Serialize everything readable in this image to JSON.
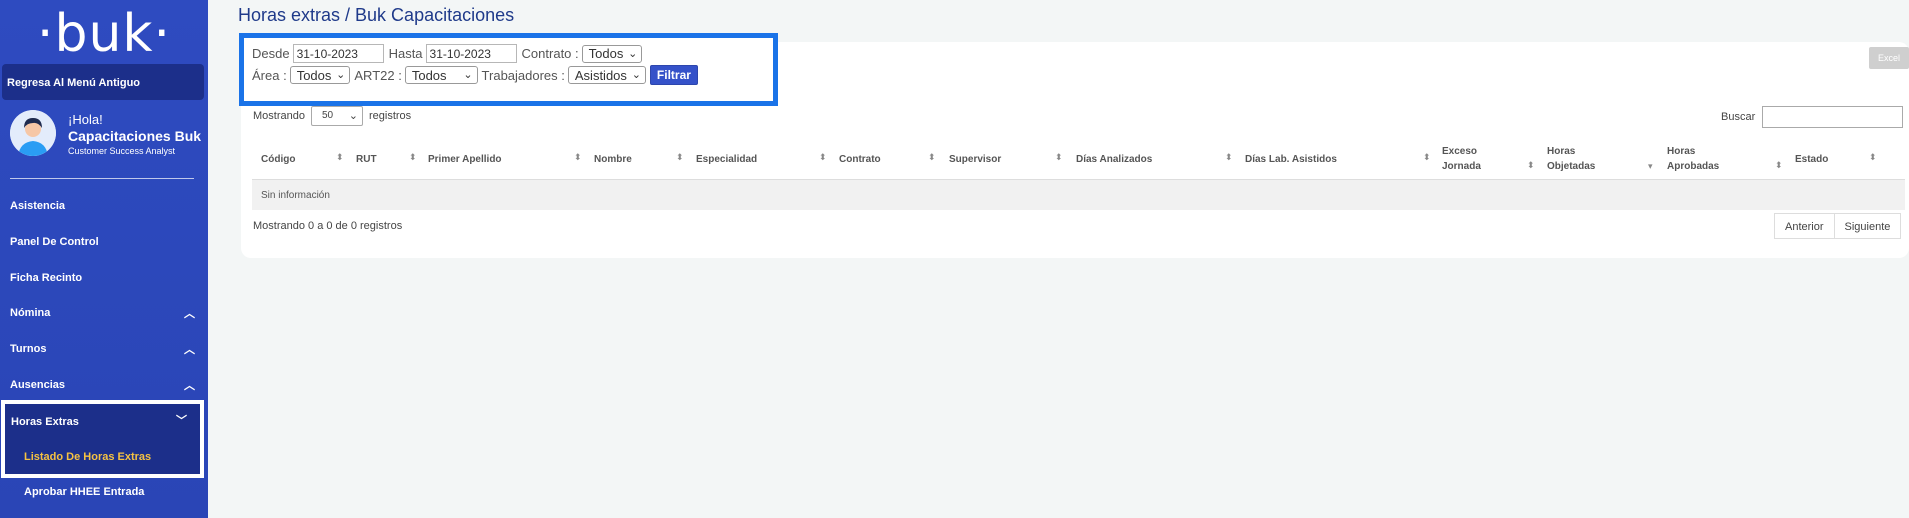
{
  "sidebar": {
    "logo": "·buk·",
    "back_label": "Regresa Al Menú Antiguo",
    "user": {
      "greeting": "¡Hola!",
      "name": "Capacitaciones Buk",
      "role": "Customer Success Analyst"
    },
    "items": [
      {
        "label": "Asistencia"
      },
      {
        "label": "Panel De Control"
      },
      {
        "label": "Ficha Recinto"
      },
      {
        "label": "Nómina",
        "icon": "chevron-up-icon"
      },
      {
        "label": "Turnos",
        "icon": "chevron-up-icon"
      },
      {
        "label": "Ausencias",
        "icon": "chevron-up-icon"
      }
    ],
    "active_group": {
      "label": "Horas Extras",
      "icon": "chevron-down-icon",
      "sub_items": [
        {
          "label": "Listado De Horas Extras"
        }
      ]
    },
    "extra_sub_item": {
      "label": "Aprobar HHEE Entrada"
    }
  },
  "page": {
    "title": "Horas extras / Buk Capacitaciones"
  },
  "filters": {
    "desde_label": "Desde",
    "desde_value": "31-10-2023",
    "hasta_label": "Hasta",
    "hasta_value": "31-10-2023",
    "contrato_label": "Contrato :",
    "contrato_value": "Todos",
    "area_label": "Área :",
    "area_value": "Todos",
    "art22_label": "ART22 :",
    "art22_value": "Todos",
    "trabajadores_label": "Trabajadores :",
    "trabajadores_value": "Asistidos",
    "filtrar_label": "Filtrar"
  },
  "table_controls": {
    "excel_label": "Excel",
    "length_prefix": "Mostrando",
    "length_value": "50",
    "length_suffix": "registros",
    "search_label": "Buscar"
  },
  "table": {
    "columns": [
      {
        "line1": "Código"
      },
      {
        "line1": "RUT"
      },
      {
        "line1": "Primer Apellido"
      },
      {
        "line1": "Nombre"
      },
      {
        "line1": "Especialidad"
      },
      {
        "line1": "Contrato"
      },
      {
        "line1": "Supervisor"
      },
      {
        "line1": "Días Analizados"
      },
      {
        "line1": "Días Lab. Asistidos"
      },
      {
        "line1": "Exceso",
        "line2": "Jornada"
      },
      {
        "line1": "Horas",
        "line2": "Objetadas"
      },
      {
        "line1": "Horas",
        "line2": "Aprobadas"
      },
      {
        "line1": "Estado"
      }
    ],
    "empty_text": "Sin información",
    "info_text": "Mostrando 0 a 0 de 0 registros",
    "prev_label": "Anterior",
    "next_label": "Siguiente"
  }
}
